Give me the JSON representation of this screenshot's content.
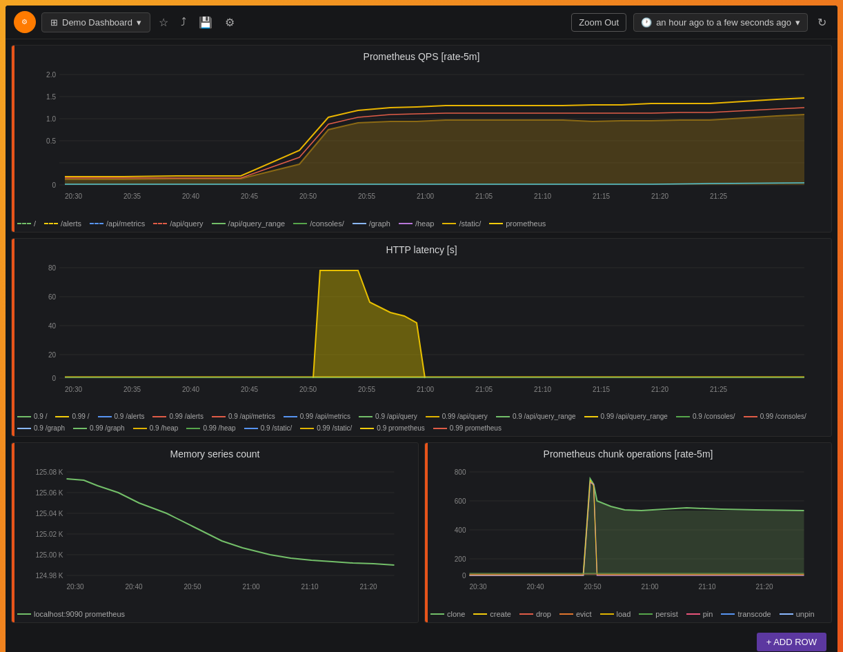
{
  "header": {
    "dashboard_label": "Demo Dashboard",
    "zoom_out_label": "Zoom Out",
    "time_range": "an hour ago to a few seconds ago",
    "add_row_label": "+ ADD ROW"
  },
  "panels": {
    "qps": {
      "title": "Prometheus QPS [rate-5m]",
      "y_axis": [
        "2.0",
        "1.5",
        "1.0",
        "0.5",
        "0"
      ],
      "x_axis": [
        "20:30",
        "20:35",
        "20:40",
        "20:45",
        "20:50",
        "20:55",
        "21:00",
        "21:05",
        "21:10",
        "21:15",
        "21:20",
        "21:25"
      ],
      "legend": [
        {
          "label": "/",
          "color": "#73bf69",
          "dash": true
        },
        {
          "label": "/alerts",
          "color": "#f2cc0c",
          "dash": true
        },
        {
          "label": "/api/metrics",
          "color": "#5794f2",
          "dash": true
        },
        {
          "label": "/api/query",
          "color": "#e05c47",
          "dash": true
        },
        {
          "label": "/api/query_range",
          "color": "#73bf69",
          "dash": false
        },
        {
          "label": "/consoles/",
          "color": "#56a64b",
          "dash": false
        },
        {
          "label": "/graph",
          "color": "#8ab8ff",
          "dash": false
        },
        {
          "label": "/heap",
          "color": "#b877d9",
          "dash": false
        },
        {
          "label": "/static/",
          "color": "#e0b400",
          "dash": false
        },
        {
          "label": "prometheus",
          "color": "#f2cc0c",
          "dash": false
        }
      ]
    },
    "latency": {
      "title": "HTTP latency [s]",
      "y_axis": [
        "80",
        "60",
        "40",
        "20",
        "0"
      ],
      "x_axis": [
        "20:30",
        "20:35",
        "20:40",
        "20:45",
        "20:50",
        "20:55",
        "21:00",
        "21:05",
        "21:10",
        "21:15",
        "21:20",
        "21:25"
      ],
      "legend": [
        {
          "label": "0.9 /",
          "color": "#73bf69"
        },
        {
          "label": "0.99 /",
          "color": "#f2cc0c"
        },
        {
          "label": "0.9 /alerts",
          "color": "#5794f2"
        },
        {
          "label": "0.99 /alerts",
          "color": "#e05c47"
        },
        {
          "label": "0.9 /api/metrics",
          "color": "#e05c47"
        },
        {
          "label": "0.99 /api/metrics",
          "color": "#5794f2"
        },
        {
          "label": "0.9 /api/query",
          "color": "#73bf69"
        },
        {
          "label": "0.99 /api/query",
          "color": "#e0b400"
        },
        {
          "label": "0.9 /api/query_range",
          "color": "#73bf69"
        },
        {
          "label": "0.99 /api/query_range",
          "color": "#f2cc0c"
        },
        {
          "label": "0.9 /consoles/",
          "color": "#56a64b"
        },
        {
          "label": "0.99 /consoles/",
          "color": "#e05c47"
        },
        {
          "label": "0.9 /graph",
          "color": "#8ab8ff"
        },
        {
          "label": "0.99 /graph",
          "color": "#73bf69"
        },
        {
          "label": "0.9 /heap",
          "color": "#e0b400"
        },
        {
          "label": "0.99 /heap",
          "color": "#56a64b"
        },
        {
          "label": "0.9 /static/",
          "color": "#5794f2"
        },
        {
          "label": "0.99 /static/",
          "color": "#e0b400"
        },
        {
          "label": "0.9 prometheus",
          "color": "#f2cc0c"
        },
        {
          "label": "0.99 prometheus",
          "color": "#e05c47"
        }
      ]
    },
    "memory": {
      "title": "Memory series count",
      "y_axis": [
        "125.08 K",
        "125.06 K",
        "125.04 K",
        "125.02 K",
        "125.00 K",
        "124.98 K"
      ],
      "x_axis": [
        "20:30",
        "20:40",
        "20:50",
        "21:00",
        "21:10",
        "21:20"
      ],
      "legend": [
        {
          "label": "localhost:9090 prometheus",
          "color": "#73bf69"
        }
      ]
    },
    "chunk_ops": {
      "title": "Prometheus chunk operations [rate-5m]",
      "y_axis": [
        "800",
        "600",
        "400",
        "200",
        "0"
      ],
      "x_axis": [
        "20:30",
        "20:40",
        "20:50",
        "21:00",
        "21:10",
        "21:20"
      ],
      "legend": [
        {
          "label": "clone",
          "color": "#73bf69"
        },
        {
          "label": "create",
          "color": "#f2cc0c"
        },
        {
          "label": "drop",
          "color": "#e05c47"
        },
        {
          "label": "evict",
          "color": "#e0752d"
        },
        {
          "label": "load",
          "color": "#e0b400"
        },
        {
          "label": "persist",
          "color": "#56a64b"
        },
        {
          "label": "pin",
          "color": "#e8547a"
        },
        {
          "label": "transcode",
          "color": "#5794f2"
        },
        {
          "label": "unpin",
          "color": "#8ab8ff"
        }
      ]
    }
  }
}
